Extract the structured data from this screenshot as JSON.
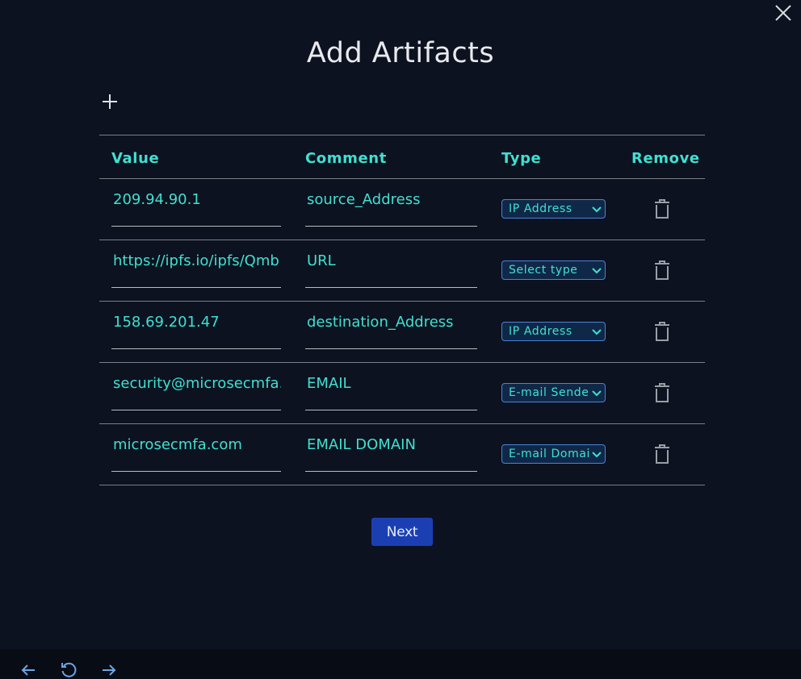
{
  "dialog": {
    "title": "Add Artifacts",
    "next_label": "Next"
  },
  "table": {
    "headers": [
      "Value",
      "Comment",
      "Type",
      "Remove"
    ],
    "rows": [
      {
        "value": "209.94.90.1",
        "comment": "source_Address",
        "type": "IP Address"
      },
      {
        "value": "https://ipfs.io/ipfs/Qmb",
        "comment": "URL",
        "type": "Select type"
      },
      {
        "value": "158.69.201.47",
        "comment": "destination_Address",
        "type": "IP Address"
      },
      {
        "value": "security@microsecmfa.",
        "comment": "EMAIL",
        "type": "E-mail Sende"
      },
      {
        "value": "microsecmfa.com",
        "comment": "EMAIL DOMAIN",
        "type": "E-mail Domai"
      }
    ]
  },
  "colors": {
    "background": "#0c1220",
    "accent_text": "#40e0d0",
    "primary_button": "#1b3fb3",
    "select_border": "#4a82d6"
  },
  "icons": {
    "close": "close-icon",
    "add": "plus-icon",
    "remove": "trash-icon",
    "back": "arrow-left-icon",
    "refresh": "refresh-icon",
    "forward": "arrow-right-icon"
  }
}
